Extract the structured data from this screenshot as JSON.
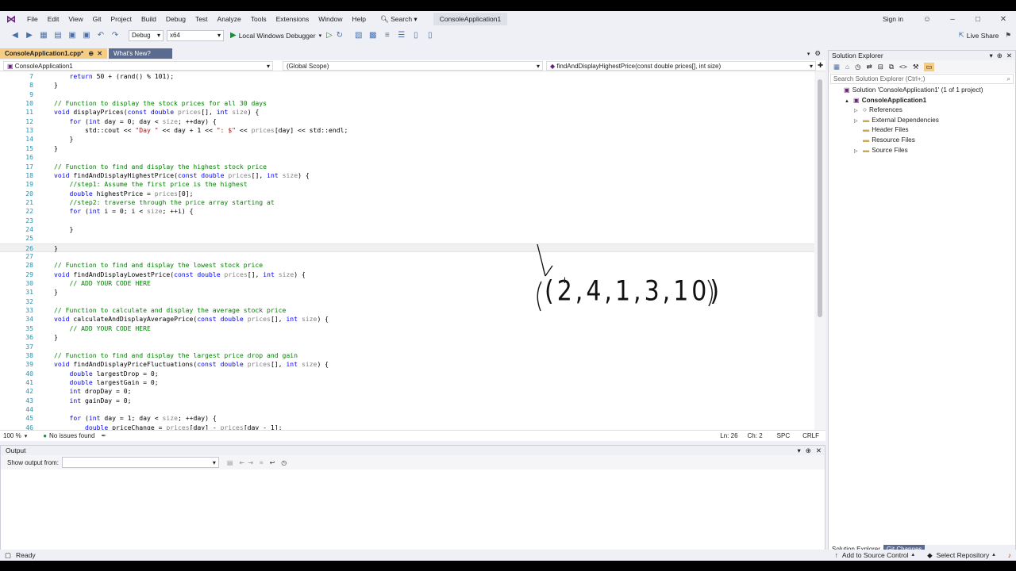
{
  "menubar": {
    "items": [
      "File",
      "Edit",
      "View",
      "Git",
      "Project",
      "Build",
      "Debug",
      "Test",
      "Analyze",
      "Tools",
      "Extensions",
      "Window",
      "Help"
    ],
    "search": "Search",
    "title": "ConsoleApplication1",
    "sign_in": "Sign in"
  },
  "toolbar": {
    "config": "Debug",
    "platform": "x64",
    "run": "Local Windows Debugger",
    "live_share": "Live Share"
  },
  "tabs": [
    {
      "label": "ConsoleApplication1.cpp*"
    },
    {
      "label": "What's New?"
    }
  ],
  "navbar": {
    "project": "ConsoleApplication1",
    "scope": "(Global Scope)",
    "member": "findAndDisplayHighestPrice(const double prices[], int size)"
  },
  "code": [
    {
      "n": "7",
      "t": "    return 50 + (rand() % 101);"
    },
    {
      "n": "8",
      "t": "}"
    },
    {
      "n": "9",
      "t": ""
    },
    {
      "n": "10",
      "t": "// Function to display the stock prices for all 30 days"
    },
    {
      "n": "11",
      "t": "void displayPrices(const double prices[], int size) {"
    },
    {
      "n": "12",
      "t": "    for (int day = 0; day < size; ++day) {"
    },
    {
      "n": "13",
      "t": "        std::cout << \"Day \" << day + 1 << \": $\" << prices[day] << std::endl;"
    },
    {
      "n": "14",
      "t": "    }"
    },
    {
      "n": "15",
      "t": "}"
    },
    {
      "n": "16",
      "t": ""
    },
    {
      "n": "17",
      "t": "// Function to find and display the highest stock price"
    },
    {
      "n": "18",
      "t": "void findAndDisplayHighestPrice(const double prices[], int size) {"
    },
    {
      "n": "19",
      "t": "    //step1: Assume the first price is the highest"
    },
    {
      "n": "20",
      "t": "    double highestPrice = prices[0];"
    },
    {
      "n": "21",
      "t": "    //step2: traverse through the price array starting at"
    },
    {
      "n": "22",
      "t": "    for (int i = 0; i < size; ++i) {"
    },
    {
      "n": "23",
      "t": ""
    },
    {
      "n": "24",
      "t": "    }"
    },
    {
      "n": "25",
      "t": ""
    },
    {
      "n": "26",
      "t": "}"
    },
    {
      "n": "27",
      "t": ""
    },
    {
      "n": "28",
      "t": "// Function to find and display the lowest stock price"
    },
    {
      "n": "29",
      "t": "void findAndDisplayLowestPrice(const double prices[], int size) {"
    },
    {
      "n": "30",
      "t": "    // ADD YOUR CODE HERE"
    },
    {
      "n": "31",
      "t": "}"
    },
    {
      "n": "32",
      "t": ""
    },
    {
      "n": "33",
      "t": "// Function to calculate and display the average stock price"
    },
    {
      "n": "34",
      "t": "void calculateAndDisplayAveragePrice(const double prices[], int size) {"
    },
    {
      "n": "35",
      "t": "    // ADD YOUR CODE HERE"
    },
    {
      "n": "36",
      "t": "}"
    },
    {
      "n": "37",
      "t": ""
    },
    {
      "n": "38",
      "t": "// Function to find and display the largest price drop and gain"
    },
    {
      "n": "39",
      "t": "void findAndDisplayPriceFluctuations(const double prices[], int size) {"
    },
    {
      "n": "40",
      "t": "    double largestDrop = 0;"
    },
    {
      "n": "41",
      "t": "    double largestGain = 0;"
    },
    {
      "n": "42",
      "t": "    int dropDay = 0;"
    },
    {
      "n": "43",
      "t": "    int gainDay = 0;"
    },
    {
      "n": "44",
      "t": ""
    },
    {
      "n": "45",
      "t": "    for (int day = 1; day < size; ++day) {"
    },
    {
      "n": "46",
      "t": "        double priceChange = prices[day] - prices[day - 1];"
    }
  ],
  "annotation": "(2,4,1,3,10)",
  "editor_status": {
    "zoom": "100 %",
    "issues": "No issues found",
    "ln": "Ln: 26",
    "ch": "Ch: 2",
    "spc": "SPC",
    "crlf": "CRLF"
  },
  "output": {
    "title": "Output",
    "show_from": "Show output from:"
  },
  "solution_explorer": {
    "title": "Solution Explorer",
    "search_placeholder": "Search Solution Explorer (Ctrl+;)",
    "items": [
      {
        "label": "Solution 'ConsoleApplication1' (1 of 1 project)",
        "indent": 0,
        "arrow": "",
        "bold": false
      },
      {
        "label": "ConsoleApplication1",
        "indent": 1,
        "arrow": "▲",
        "bold": true
      },
      {
        "label": "References",
        "indent": 2,
        "arrow": "▷",
        "bold": false
      },
      {
        "label": "External Dependencies",
        "indent": 2,
        "arrow": "▷",
        "bold": false
      },
      {
        "label": "Header Files",
        "indent": 2,
        "arrow": "",
        "bold": false
      },
      {
        "label": "Resource Files",
        "indent": 2,
        "arrow": "",
        "bold": false
      },
      {
        "label": "Source Files",
        "indent": 2,
        "arrow": "▷",
        "bold": false
      }
    ],
    "bottom_tabs": [
      "Solution Explorer",
      "Git Changes"
    ]
  },
  "statusbar": {
    "ready": "Ready",
    "source_control": "Add to Source Control",
    "repository": "Select Repository"
  }
}
